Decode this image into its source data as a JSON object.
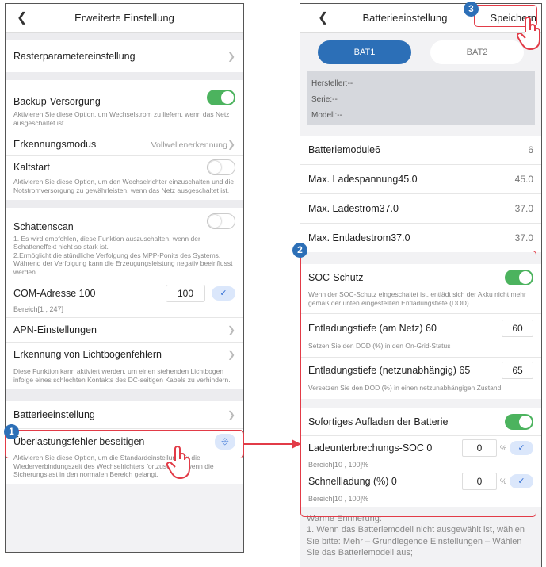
{
  "left": {
    "title": "Erweiterte Einstellung",
    "raster": "Rasterparametereinstellung",
    "backup": {
      "label": "Backup-Versorgung",
      "desc": "Aktivieren Sie diese Option, um Wechselstrom zu liefern, wenn das Netz ausgeschaltet ist."
    },
    "erkennung": {
      "label": "Erkennungsmodus",
      "value": "Vollwellenerkennung"
    },
    "kaltstart": {
      "label": "Kaltstart",
      "desc": "Aktivieren Sie diese Option, um den Wechselrichter einzuschalten und die Notstromversorgung zu gewährleisten, wenn das Netz ausgeschaltet ist."
    },
    "schatten": {
      "label": "Schattenscan",
      "desc1": "1. Es wird empfohlen, diese Funktion auszuschalten, wenn der Schatteneffekt nicht so stark ist.",
      "desc2": "2.Ermöglicht die stündliche Verfolgung des MPP-Ponits des Systems. Während der Verfolgung kann die Erzeugungsleistung negativ beeinflusst werden."
    },
    "com": {
      "label": "COM-Adresse 100",
      "value": "100",
      "range": "Bereich[1 , 247]"
    },
    "apn": "APN-Einstellungen",
    "lichtbogen": {
      "label": "Erkennung von Lichtbogenfehlern",
      "desc": "Diese Funktion kann aktiviert werden, um einen stehenden Lichtbogen infolge eines schlechten Kontakts des DC-seitigen Kabels zu verhindern."
    },
    "batterie": "Batterieeinstellung",
    "ueberlast": {
      "label": "Überlastungsfehler beseitigen",
      "desc": "Aktivieren Sie diese Option, um die Standardeinstellung für die Wiederverbindungszeit des Wechselrichters fortzusetzen, wenn die Sicherungslast in den normalen Bereich gelangt."
    }
  },
  "right": {
    "title": "Batterieeinstellung",
    "save": "Speichern",
    "tabs": [
      "BAT1",
      "BAT2"
    ],
    "info": [
      "Hersteller:--",
      "Serie:--",
      "Modell:--"
    ],
    "rows": [
      {
        "label": "Batteriemodule6",
        "value": "6"
      },
      {
        "label": "Max. Ladespannung45.0",
        "value": "45.0"
      },
      {
        "label": "Max. Ladestrom37.0",
        "value": "37.0"
      },
      {
        "label": "Max. Entladestrom37.0",
        "value": "37.0"
      }
    ],
    "soc": {
      "label": "SOC-Schutz",
      "desc": "Wenn der SOC-Schutz eingeschaltet ist, entlädt sich der Akku nicht mehr gemäß der unten eingestellten Entladungstiefe (DOD)."
    },
    "dod_grid": {
      "label": "Entladungstiefe (am Netz) 60",
      "value": "60",
      "desc": "Setzen Sie den DOD (%) in den On-Grid-Status"
    },
    "dod_off": {
      "label": "Entladungstiefe (netzunabhängig) 65",
      "value": "65",
      "desc": "Versetzen Sie den DOD (%) in einen netzunabhängigen Zustand"
    },
    "sofort": "Sofortiges Aufladen der Batterie",
    "lade_soc": {
      "label": "Ladeunterbrechungs-SOC 0",
      "value": "0",
      "unit": "%",
      "range": "Bereich[10 , 100]%"
    },
    "schnell": {
      "label": "Schnellladung (%) 0",
      "value": "0",
      "unit": "%",
      "range": "Bereich[10 , 100]%"
    },
    "warn": [
      "Warme Erinnerung:",
      "1. Wenn das Batteriemodell nicht ausgewählt ist, wählen Sie bitte: Mehr – Grundlegende Einstellungen – Wählen Sie das Batteriemodell aus;"
    ]
  },
  "badges": [
    "1",
    "2",
    "3"
  ],
  "colors": {
    "accent": "#2c6fb7",
    "toggle_on": "#4cb35e",
    "highlight": "#e23b47"
  }
}
